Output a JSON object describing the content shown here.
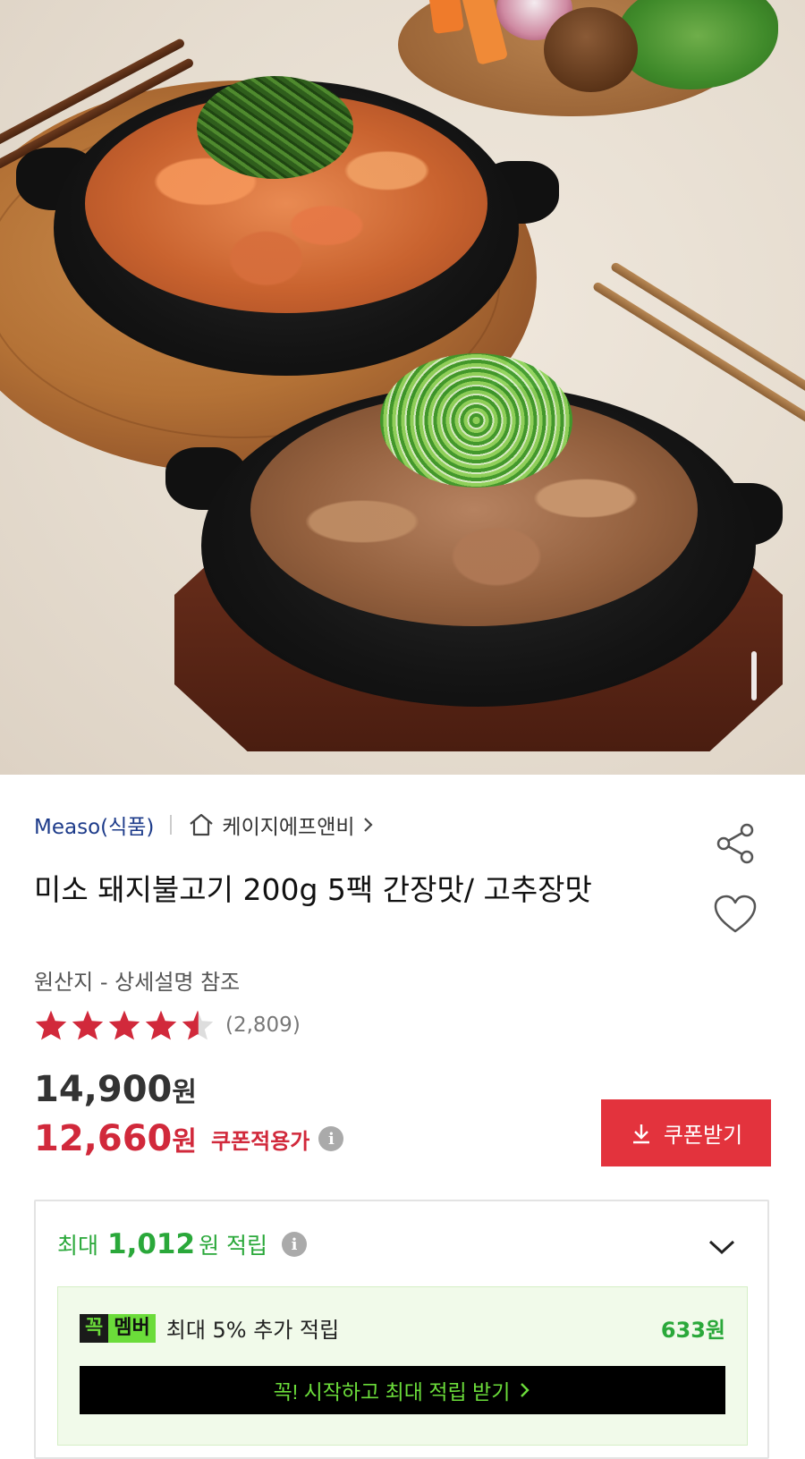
{
  "seller": {
    "brand": "Measo(식품)",
    "store_name": "케이지에프앤비"
  },
  "product": {
    "title": "미소 돼지불고기 200g 5팩 간장맛/ 고추장맛",
    "origin": "원산지 - 상세설명 참조",
    "rating": 4.5,
    "review_count": "(2,809)"
  },
  "price": {
    "original_amount": "14,900",
    "sale_amount": "12,660",
    "currency": "원",
    "coupon_label": "쿠폰적용가",
    "coupon_button": "쿠폰받기"
  },
  "reward": {
    "prefix": "최대",
    "amount": "1,012",
    "suffix": "원 적립",
    "member": {
      "badge_left": "꼭",
      "badge_right": "멤버",
      "text": "최대 5% 추가 적립",
      "amount": "633원",
      "cta": "꼭! 시작하고 최대 적립 받기"
    }
  },
  "colors": {
    "brand_blue": "#1d3b8a",
    "sale_red": "#d1293b",
    "coupon_button": "#e3333d",
    "reward_green": "#2aa83a",
    "member_green": "#6bdc3a"
  },
  "icons": [
    "home-icon",
    "chevron-right-icon",
    "share-icon",
    "heart-icon",
    "star-icon",
    "info-icon",
    "download-icon",
    "chevron-down-icon"
  ]
}
